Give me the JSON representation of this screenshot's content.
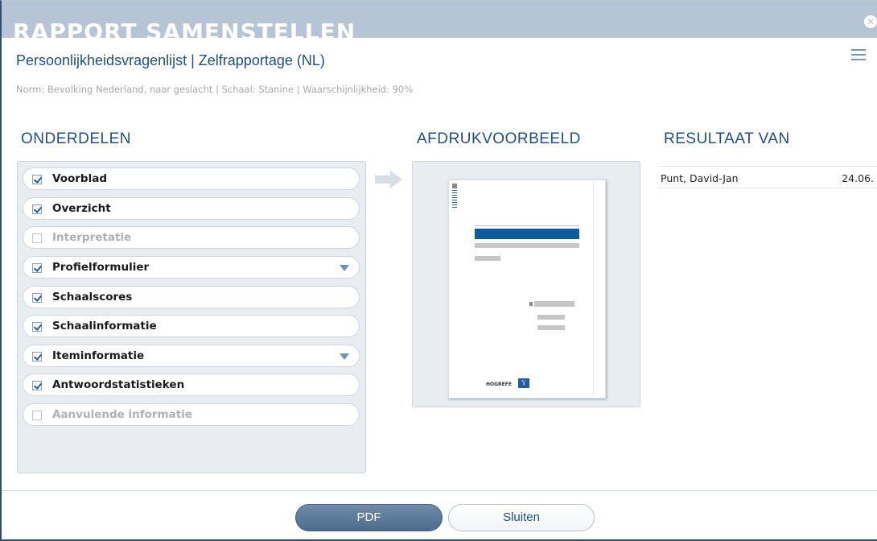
{
  "window": {
    "title": "RAPPORT SAMENSTELLEN",
    "close_icon": "close-icon",
    "subtitle": "Persoonlijkheidsvragenlijst | Zelfrapportage (NL)",
    "norm_line": "Norm: Bevolking Nederland, naar geslacht | Schaal: Stanine | Waarschijnlijkheid: 90%"
  },
  "sections": {
    "onderdelen": "ONDERDELEN",
    "afdrukvoorbeeld": "AFDRUKVOORBEELD",
    "resultaat_van": "RESULTAAT VAN"
  },
  "parts": [
    {
      "label": "Voorblad",
      "checked": true,
      "enabled": true,
      "dropdown": false
    },
    {
      "label": "Overzicht",
      "checked": true,
      "enabled": true,
      "dropdown": false
    },
    {
      "label": "Interpretatie",
      "checked": false,
      "enabled": false,
      "dropdown": false
    },
    {
      "label": "Profielformulier",
      "checked": true,
      "enabled": true,
      "dropdown": true
    },
    {
      "label": "Schaalscores",
      "checked": true,
      "enabled": true,
      "dropdown": false
    },
    {
      "label": "Schaalinformatie",
      "checked": true,
      "enabled": true,
      "dropdown": false
    },
    {
      "label": "Iteminformatie",
      "checked": true,
      "enabled": true,
      "dropdown": true
    },
    {
      "label": "Antwoordstatistieken",
      "checked": true,
      "enabled": true,
      "dropdown": false
    },
    {
      "label": "Aanvulende informatie",
      "checked": false,
      "enabled": false,
      "dropdown": false
    }
  ],
  "preview": {
    "logo_text": "HOGREFE",
    "logo_mark": "𝕐"
  },
  "result": {
    "name": "Punt, David-Jan",
    "date": "24.06."
  },
  "buttons": {
    "pdf": "PDF",
    "sluiten": "Sluiten"
  },
  "colors": {
    "titlebar": "#b5c5d6",
    "accent": "#1d4f85",
    "primary_button": "#5a7898"
  }
}
